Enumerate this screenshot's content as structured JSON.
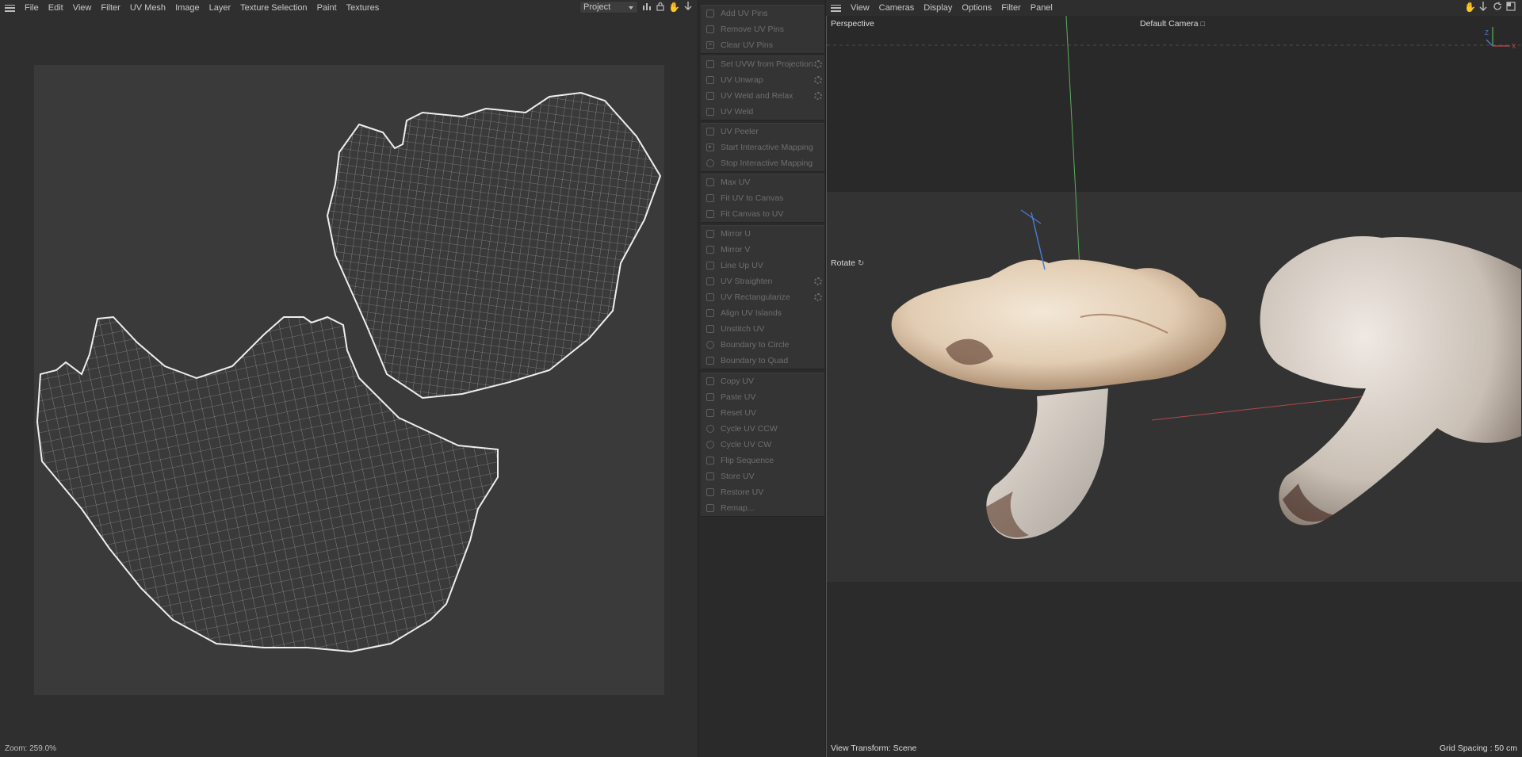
{
  "uv_editor": {
    "menu": [
      "File",
      "Edit",
      "View",
      "Filter",
      "UV Mesh",
      "Image",
      "Layer",
      "Texture Selection",
      "Paint",
      "Textures"
    ],
    "project_select": "Project",
    "toolbar_icons": [
      "histogram-icon",
      "lock-icon",
      "hand-pan-icon",
      "zoom-move-icon"
    ],
    "status": "Zoom: 259.0%"
  },
  "palette": {
    "groups": [
      [
        {
          "label": "Add UV Pins",
          "icon": "pin-icon"
        },
        {
          "label": "Remove UV Pins",
          "icon": "pin-icon"
        },
        {
          "label": "Clear UV Pins",
          "icon": "close-icon"
        }
      ],
      [
        {
          "label": "Set UVW from Projection",
          "icon": "projection-icon",
          "gear": true
        },
        {
          "label": "UV Unwrap",
          "icon": "unwrap-icon",
          "gear": true
        },
        {
          "label": "UV Weld and Relax",
          "icon": "weld-icon",
          "gear": true
        },
        {
          "label": "UV Weld",
          "icon": "weld-icon"
        }
      ],
      [
        {
          "label": "UV Peeler",
          "icon": "peeler-icon"
        },
        {
          "label": "Start Interactive Mapping",
          "icon": "play-icon"
        },
        {
          "label": "Stop Interactive Mapping",
          "icon": "stop-icon"
        }
      ],
      [
        {
          "label": "Max UV",
          "icon": "max-icon"
        },
        {
          "label": "Fit UV to Canvas",
          "icon": "fit-icon"
        },
        {
          "label": "Fit Canvas to UV",
          "icon": "fit-icon"
        }
      ],
      [
        {
          "label": "Mirror U",
          "icon": "mirror-icon"
        },
        {
          "label": "Mirror V",
          "icon": "mirror-icon"
        },
        {
          "label": "Line Up UV",
          "icon": "lineup-icon"
        },
        {
          "label": "UV Straighten",
          "icon": "straighten-icon",
          "gear": true
        },
        {
          "label": "UV Rectangularize",
          "icon": "rectangularize-icon",
          "gear": true
        },
        {
          "label": "Align UV Islands",
          "icon": "align-icon"
        },
        {
          "label": "Unstitch UV",
          "icon": "unstitch-icon"
        },
        {
          "label": "Boundary to Circle",
          "icon": "circle-icon"
        },
        {
          "label": "Boundary to Quad",
          "icon": "quad-icon"
        }
      ],
      [
        {
          "label": "Copy UV",
          "icon": "copy-icon"
        },
        {
          "label": "Paste UV",
          "icon": "paste-icon"
        },
        {
          "label": "Reset UV",
          "icon": "reset-icon"
        },
        {
          "label": "Cycle UV CCW",
          "icon": "cycle-icon"
        },
        {
          "label": "Cycle UV CW",
          "icon": "cycle-icon"
        },
        {
          "label": "Flip Sequence",
          "icon": "flip-icon"
        },
        {
          "label": "Store UV",
          "icon": "store-icon"
        },
        {
          "label": "Restore UV",
          "icon": "restore-icon"
        },
        {
          "label": "Remap...",
          "icon": "remap-icon"
        }
      ]
    ]
  },
  "viewport": {
    "menu": [
      "View",
      "Cameras",
      "Display",
      "Options",
      "Filter",
      "Panel"
    ],
    "nav_icons": [
      "hand-pan-icon",
      "move-icon",
      "rotate-icon",
      "maximize-icon"
    ],
    "perspective": "Perspective",
    "camera": "Default Camera",
    "rotate": "Rotate",
    "view_transform": "View Transform: Scene",
    "grid_spacing": "Grid Spacing : 50 cm",
    "axes": [
      "Z",
      "X"
    ]
  }
}
